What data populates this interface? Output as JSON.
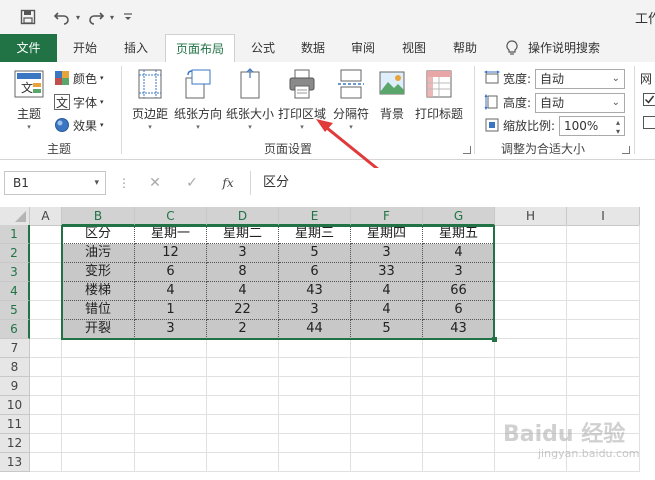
{
  "titlebar": {
    "title": "工作",
    "icons": [
      "save-icon",
      "undo-icon",
      "redo-icon",
      "customize-icon"
    ]
  },
  "tabs": [
    {
      "label": "文件"
    },
    {
      "label": "开始"
    },
    {
      "label": "插入"
    },
    {
      "label": "页面布局"
    },
    {
      "label": "公式"
    },
    {
      "label": "数据"
    },
    {
      "label": "审阅"
    },
    {
      "label": "视图"
    },
    {
      "label": "帮助"
    },
    {
      "label": "操作说明搜索"
    }
  ],
  "ribbon": {
    "themes": {
      "theme_label": "主题",
      "colors_label": "颜色",
      "fonts_label": "字体",
      "effects_label": "效果",
      "group_label": "主题"
    },
    "page_setup": {
      "margins_label": "页边距",
      "orientation_label": "纸张方向",
      "size_label": "纸张大小",
      "print_area_label": "打印区域",
      "breaks_label": "分隔符",
      "background_label": "背景",
      "print_titles_label": "打印标题",
      "group_label": "页面设置"
    },
    "scale": {
      "width_label": "宽度:",
      "width_value": "自动",
      "height_label": "高度:",
      "height_value": "自动",
      "scale_label": "缩放比例:",
      "scale_value": "100%",
      "group_label": "调整为合适大小"
    },
    "sheet_options": {
      "partial_label": "网"
    }
  },
  "formula_bar": {
    "name_box": "B1",
    "fx": "fx",
    "content": "区分"
  },
  "sheet": {
    "columns": [
      "A",
      "B",
      "C",
      "D",
      "E",
      "F",
      "G",
      "H",
      "I"
    ],
    "rows": [
      "1",
      "2",
      "3",
      "4",
      "5",
      "6",
      "7",
      "8",
      "9",
      "10",
      "11",
      "12",
      "13"
    ],
    "table": [
      [
        "区分",
        "星期一",
        "星期二",
        "星期三",
        "星期四",
        "星期五"
      ],
      [
        "油污",
        "12",
        "3",
        "5",
        "3",
        "4"
      ],
      [
        "变形",
        "6",
        "8",
        "6",
        "33",
        "3"
      ],
      [
        "楼梯",
        "4",
        "4",
        "43",
        "4",
        "66"
      ],
      [
        "错位",
        "1",
        "22",
        "3",
        "4",
        "6"
      ],
      [
        "开裂",
        "3",
        "2",
        "44",
        "5",
        "43"
      ]
    ]
  },
  "watermark": {
    "text": "Baidu 经验",
    "sub": "jingyan.baidu.com"
  },
  "colors": {
    "excel_green": "#217346",
    "arrow_red": "#e03a3a"
  }
}
